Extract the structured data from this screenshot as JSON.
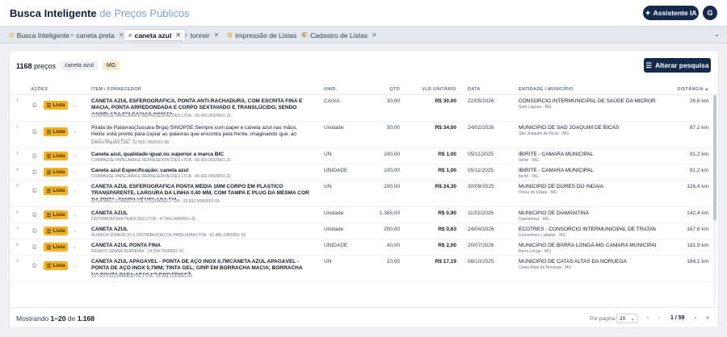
{
  "header": {
    "title_main": "Busca Inteligente",
    "title_sub": "de Preços Públicos",
    "ai_button": "Assistente IA",
    "avatar_initial": "G"
  },
  "tabs": [
    {
      "label": "Busca Inteligente",
      "icon": "pin-icon",
      "closable": false,
      "active": false
    },
    {
      "label": "caneta preta",
      "icon": "search-icon",
      "closable": true,
      "active": false
    },
    {
      "label": "caneta azul",
      "icon": "search-icon",
      "closable": true,
      "active": true
    },
    {
      "label": "tonner",
      "icon": "search-icon",
      "closable": true,
      "active": false
    },
    {
      "label": "Impressão de Listas",
      "icon": "gear-icon",
      "closable": true,
      "active": false
    },
    {
      "label": "Cadastro de Listas",
      "icon": "list-icon",
      "closable": true,
      "active": false
    }
  ],
  "summary": {
    "count": "1168",
    "count_suffix": "preços",
    "term_chip": "caneta azul",
    "uf_chip": "MG",
    "alter_button": "Alterar pesquisa"
  },
  "columns": {
    "acoes": "AÇÕES",
    "item": "ITEM / FORNECEDOR",
    "unid": "UNID.",
    "qtd": "QTD",
    "vlr": "VLR UNITÁRIO",
    "data": "DATA",
    "entidade": "ENTIDADE / MUNICÍPIO",
    "distancia": "DISTÂNCIA"
  },
  "lista_label": "Lista",
  "rows": [
    {
      "n": "1",
      "desc": "CANETA AZUL ESFEROGRÁFICA, PONTA ANTI-RACHADURA, COM ESCRITA FINA E MACIA, PONTA ARREDONDADA E CORPO SEXTAVADO E TRANSLÚCIDO, SENDO ACOPLADA EM CAIXAS COM 50...",
      "bold": true,
      "forn": "COMPASSE PAPELARIA E REPRESENTACOES LTDA · 06.420.003/0001-21",
      "unid": "CAIXA",
      "qtd": "30,00",
      "vlr": "R$ 30,00",
      "data": "22/05/2026",
      "ent": "CONSORCIO INTERMUNICIPAL DE SAUDE DA MICROREGIAO ...",
      "mun": "Sete Lagoas · MG",
      "dist": "26,6 km"
    },
    {
      "n": "2",
      "desc": "Pirata de Palavras(Jussara Brga) SINOPSE:Sempre com papel e caneta azul nas mãos, Heitor está pronto para copiar as palavras que encontra pela frente, imaginando que, ao reuni-las, poderá c",
      "bold": false,
      "forn": "Editora Miguilim Ltda · 22.563.796/0001-98",
      "unid": "Unidade",
      "qtd": "30,00",
      "vlr": "R$ 34,00",
      "data": "24/02/2026",
      "ent": "MUNICIPIO DE SAO JOAQUIM DE BICAS",
      "mun": "São Joaquim de Bicas · MG",
      "dist": "87,2 km"
    },
    {
      "n": "3",
      "desc": "Caneta azul, qualidade igual ou superior a marca BIC",
      "bold": true,
      "forn": "COMPASSE PAPELARIA E REPRESENTACOES LTDA · 06.420.003/0001-21",
      "unid": "UN",
      "qtd": "100,00",
      "vlr": "R$ 1,00",
      "data": "05/11/2025",
      "ent": "IBIRITE - CAMARA MUNICIPAL",
      "mun": "Ibirité · MG",
      "dist": "91,2 km"
    },
    {
      "n": "4",
      "desc": "Caneta azul Especificação: caneta azul",
      "bold": true,
      "forn": "COMPASSE PAPELARIA E REPRESENTACOES LTDA · 06.420.003/0001-21",
      "unid": "UNIDADE",
      "qtd": "100,00",
      "vlr": "R$ 1,00",
      "data": "05/11/2025",
      "ent": "IBIRITE - CAMARA MUNICIPAL",
      "mun": "Ibirité · MG",
      "dist": "91,2 km"
    },
    {
      "n": "5",
      "desc": "CANETA AZUL ESFEROGRÁFICA PONTA MÉDIA 1MM CORPO EM PLÁSTICO TRANSPARENTE, LARGURA DA LINHA 0,40 MM, COM TAMPA E PLUG DA MESMA COR DA TINTA, TAMPA VENTILADA EM...",
      "bold": true,
      "forn": "ATIVA MALL COMERCIO DE UTILIDADES LTDA · 33.663.568/0001-09",
      "unid": "UN",
      "qtd": "200,00",
      "vlr": "R$ 24,30",
      "data": "30/09/2025",
      "ent": "MUNICIPIO DE DORES DO INDAIA",
      "mun": "Dores do Indaiá · MG",
      "dist": "126,4 km"
    },
    {
      "n": "6",
      "desc": "CANETA AZUL",
      "bold": true,
      "forn": "DISTRIBUIDORA FRANCINO LTDA · 47.860.099/0001-05",
      "unid": "Unidade",
      "qtd": "1.365,00",
      "vlr": "R$ 0,90",
      "data": "11/02/2026",
      "ent": "MUNICIPIO DE DIAMANTINA",
      "mun": "Diamantina · MG",
      "dist": "142,4 km"
    },
    {
      "n": "7",
      "desc": "CANETA AZUL",
      "bold": true,
      "forn": "ALIANCA COMERCIO E DISTRIBUICAO DE PAPELARIA LTDA · 31.886.195/0001-55",
      "unid": "Unidade",
      "qtd": "200,00",
      "vlr": "R$ 0,63",
      "data": "24/04/2026",
      "ent": "ECOTRES - CONSORCIO INTERMUNICIPAL DE TRATAMENTO ...",
      "mun": "Conselheiro Lafaiete · MG",
      "dist": "167,6 km"
    },
    {
      "n": "8",
      "desc": "CANETA AZUL PONTA FINA",
      "bold": true,
      "forn": "RENATO SENNA FERREIRA · 14.934.769/0001-91",
      "unid": "UNIDADE",
      "qtd": "40,00",
      "vlr": "R$ 2,00",
      "data": "20/07/2026",
      "ent": "MUNICIPIO DE BARRA LONGA-MG CAMARA MUNICIPAL",
      "mun": "Barra Longa · MG",
      "dist": "181,9 km"
    },
    {
      "n": "9",
      "desc": "CANETA AZUL APAGÁVEL - PONTA DE AÇO INOX 0,7MCANETA AZUL APAGÁVEL - PONTA DE AÇO INOX 0,7MM; TINTA GEL; GRIP EM BORRACHA MACIA; BORRACHA NA PONTA PARA APAGAR POR FRICÇÃ...",
      "bold": true,
      "forn": "V2 TECH EQUIPAMENTOS LTDA · 58.434.319/0001-09",
      "unid": "UN",
      "qtd": "10,00",
      "vlr": "R$ 17,19",
      "data": "08/10/2025",
      "ent": "MUNICIPIO DE CATAS ALTAS DA NORUEGA",
      "mun": "Catas Altas da Noruega · MG",
      "dist": "184,1 km"
    }
  ],
  "footer": {
    "shown_prefix": "Mostrando",
    "shown_range": "1–20",
    "shown_mid": "de",
    "shown_total": "1.168",
    "per_page_label": "Por página",
    "per_page_value": "20",
    "pages": "1 / 59"
  }
}
